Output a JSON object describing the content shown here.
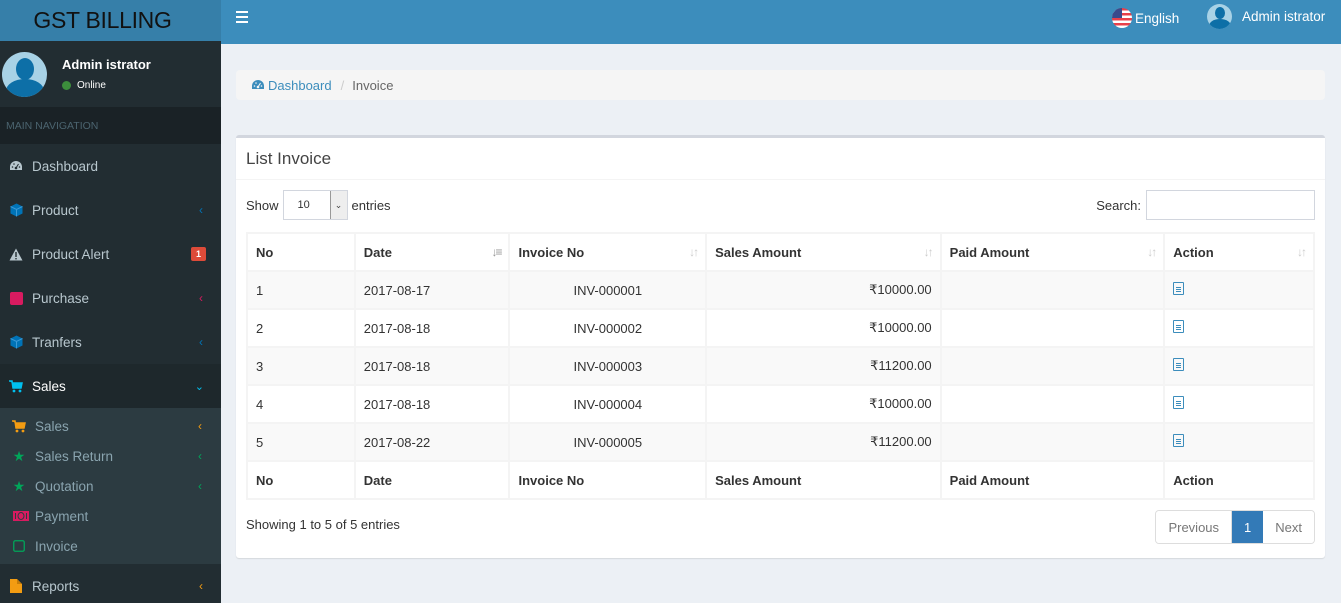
{
  "app": {
    "logo": "GST BILLING"
  },
  "user": {
    "name": "Admin istrator",
    "status": "Online"
  },
  "sidebar": {
    "header": "MAIN NAVIGATION",
    "items": [
      {
        "label": "Dashboard",
        "icon": "dashboard-icon",
        "icon_color": "#b8c7ce"
      },
      {
        "label": "Product",
        "icon": "cube-icon",
        "icon_color": "#0073b7",
        "chevron_color": "#0073b7"
      },
      {
        "label": "Product Alert",
        "icon": "warning-icon",
        "icon_color": "#b8c7ce",
        "badge": "1"
      },
      {
        "label": "Purchase",
        "icon": "square-icon",
        "icon_color": "#d81b60",
        "chevron_color": "#d81b60"
      },
      {
        "label": "Tranfers",
        "icon": "cube-icon",
        "icon_color": "#0073b7",
        "chevron_color": "#0073b7"
      },
      {
        "label": "Sales",
        "icon": "cart-icon",
        "icon_color": "#00c0ef",
        "chevron_color": "#00c0ef",
        "expanded": true
      }
    ],
    "sales_submenu": [
      {
        "label": "Sales",
        "icon": "cart-icon",
        "icon_color": "#f39c12"
      },
      {
        "label": "Sales Return",
        "icon": "star-icon",
        "icon_color": "#00a65a"
      },
      {
        "label": "Quotation",
        "icon": "star-icon",
        "icon_color": "#00a65a"
      },
      {
        "label": "Payment",
        "icon": "money-icon",
        "icon_color": "#d81b60"
      },
      {
        "label": "Invoice",
        "icon": "square-outline-icon",
        "icon_color": "#00a65a"
      }
    ],
    "reports": {
      "label": "Reports",
      "icon": "file-icon",
      "icon_color": "#f39c12"
    }
  },
  "topbar": {
    "language": "English",
    "user": "Admin istrator"
  },
  "breadcrumb": {
    "home": "Dashboard",
    "current": "Invoice"
  },
  "box": {
    "title": "List Invoice",
    "show_label": "Show",
    "page_size": "10",
    "entries_label": "entries",
    "search_label": "Search:",
    "search_value": "",
    "columns": [
      "No",
      "Date",
      "Invoice No",
      "Sales Amount",
      "Paid Amount",
      "Action"
    ],
    "rows": [
      {
        "no": "1",
        "date": "2017-08-17",
        "invoice": "INV-000001",
        "sales": "₹10000.00",
        "paid": ""
      },
      {
        "no": "2",
        "date": "2017-08-18",
        "invoice": "INV-000002",
        "sales": "₹10000.00",
        "paid": ""
      },
      {
        "no": "3",
        "date": "2017-08-18",
        "invoice": "INV-000003",
        "sales": "₹11200.00",
        "paid": ""
      },
      {
        "no": "4",
        "date": "2017-08-18",
        "invoice": "INV-000004",
        "sales": "₹10000.00",
        "paid": ""
      },
      {
        "no": "5",
        "date": "2017-08-22",
        "invoice": "INV-000005",
        "sales": "₹11200.00",
        "paid": ""
      }
    ],
    "info": "Showing 1 to 5 of 5 entries",
    "pager": {
      "prev": "Previous",
      "page": "1",
      "next": "Next"
    }
  }
}
